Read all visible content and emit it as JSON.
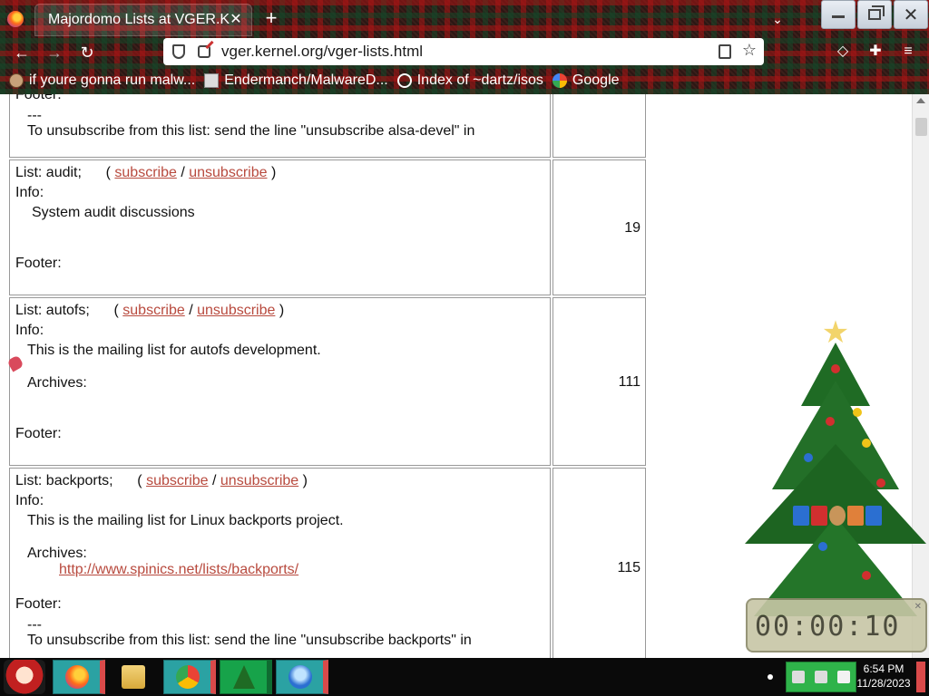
{
  "browser": {
    "tab_title": "Majordomo Lists at VGER.K",
    "url": "vger.kernel.org/vger-lists.html",
    "bookmarks": [
      {
        "label": "if youre gonna run malw...",
        "icon": "avatar-icon"
      },
      {
        "label": "Endermanch/MalwareD...",
        "icon": "page-icon"
      },
      {
        "label": "Index of ~dartz/isos",
        "icon": "globe-icon"
      },
      {
        "label": "Google",
        "icon": "google-icon"
      }
    ]
  },
  "page": {
    "partial_top": {
      "footer_label": "Footer:",
      "sep": "---",
      "unsub": "To unsubscribe from this list: send the line \"unsubscribe alsa-devel\" in"
    },
    "lists": [
      {
        "name_line": "List: audit;",
        "open": "(",
        "subscribe": "subscribe",
        "slash": "/",
        "unsubscribe": "unsubscribe",
        "close": ")",
        "info_label": "Info:",
        "info": "System audit discussions",
        "footer_label": "Footer:",
        "count": "19"
      },
      {
        "name_line": "List: autofs;",
        "open": "(",
        "subscribe": "subscribe",
        "slash": "/",
        "unsubscribe": "unsubscribe",
        "close": ")",
        "info_label": "Info:",
        "info": "This is the mailing list for autofs development.",
        "archives_label": "Archives:",
        "footer_label": "Footer:",
        "count": "111"
      },
      {
        "name_line": "List: backports;",
        "open": "(",
        "subscribe": "subscribe",
        "slash": "/",
        "unsubscribe": "unsubscribe",
        "close": ")",
        "info_label": "Info:",
        "info": "This is the mailing list for Linux backports project.",
        "archives_label": "Archives:",
        "archive_link": "http://www.spinics.net/lists/backports/",
        "footer_label": "Footer:",
        "sep": "---",
        "unsub": "To unsubscribe from this list: send the line \"unsubscribe backports\" in",
        "count": "115"
      }
    ]
  },
  "widget": {
    "clock_digits": "00:00:10"
  },
  "taskbar": {
    "time": "6:54 PM",
    "date": "11/28/2023"
  },
  "colors": {
    "link": "#b84a3e",
    "taskbar_teal": "#2ba2a3",
    "taskbar_green": "#17a34a"
  }
}
